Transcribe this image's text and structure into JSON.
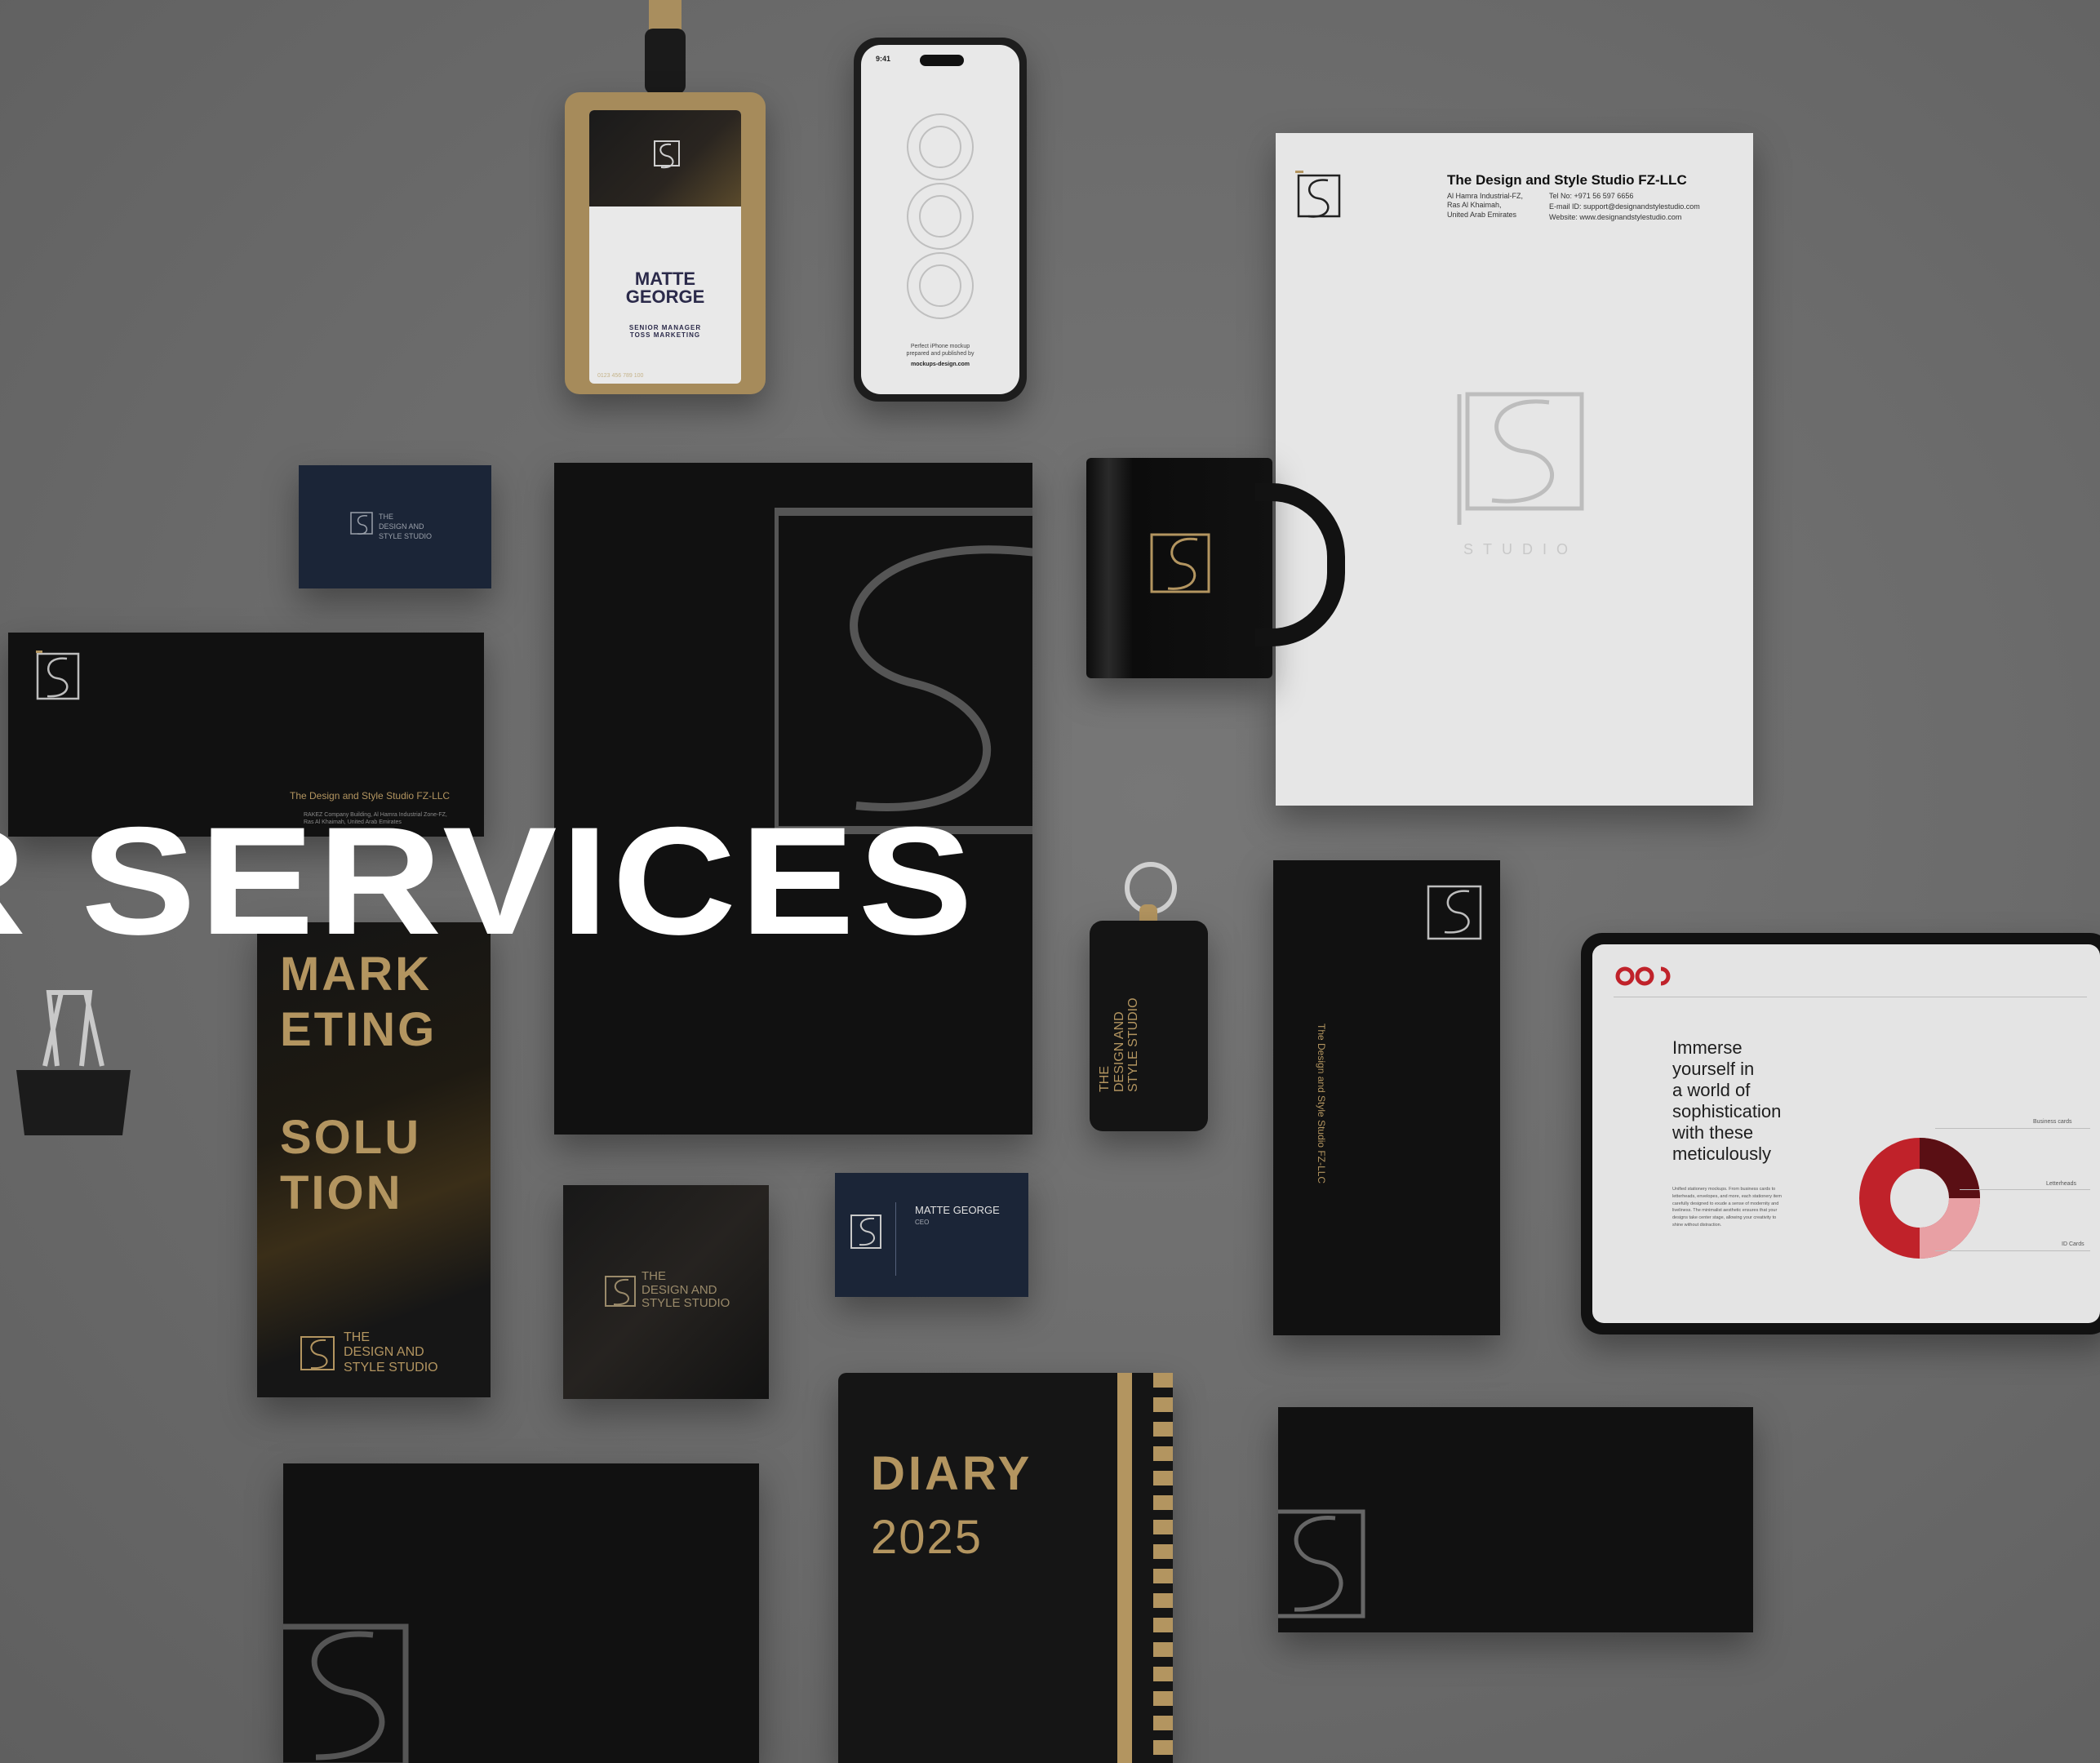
{
  "hero": {
    "headline": "R SERVICES"
  },
  "id_badge": {
    "name": "MATTE\nGEORGE",
    "role": "SENIOR MANAGER\nTOSS MARKETING",
    "phone": "0123 456 789 100"
  },
  "phone_mockup": {
    "time": "9:41",
    "caption": "Perfect iPhone mockup\nprepared and published by",
    "credit": "mockups-design.com"
  },
  "letterhead": {
    "company": "The Design and Style Studio FZ-LLC",
    "address": "Al Hamra Industrial-FZ,\nRas Al Khaimah,\nUnited Arab Emirates",
    "tel": "Tel No: +971 56 597 6656",
    "email": "E-mail ID: support@designandstylestudio.com",
    "website": "Website: www.designandstylestudio.com",
    "logo_word": "STUDIO"
  },
  "small_card": {
    "line1": "THE",
    "line2": "DESIGN AND",
    "line3": "STYLE STUDIO"
  },
  "envelope": {
    "company": "The Design and Style Studio FZ-LLC",
    "address": "RAKEZ Company Building, Al Hamra Industrial Zone-FZ,\nRas Al Khaimah, United Arab Emirates"
  },
  "brochure": {
    "line1": "MARK",
    "line2": "ETING",
    "line3": "SOLU",
    "line4": "TION",
    "brand": "THE\nDESIGN AND\nSTYLE STUDIO"
  },
  "box": {
    "brand": "THE\nDESIGN AND\nSTYLE STUDIO"
  },
  "business_card": {
    "name": "MATTE GEORGE",
    "title": "CEO"
  },
  "keychain": {
    "brand": "THE\nDESIGN AND\nSTYLE STUDIO"
  },
  "dl_envelope": {
    "company": "The Design and Style Studio FZ-LLC"
  },
  "diary": {
    "title": "DIARY",
    "year": "2025"
  },
  "tablet": {
    "heading": "Immerse\nyourself in\na world of\nsophistication\nwith these\nmeticulously",
    "body": "Unified stationery mockups. From business cards to letterheads, envelopes, and more, each stationery item carefully designed to exude a sense of modernity and liveliness. The minimalist aesthetic ensures that your designs take center stage, allowing your creativity to shine without distraction.",
    "chart_labels": [
      "Business cards",
      "Letterheads",
      "ID Cards"
    ]
  },
  "colors": {
    "gold": "#b39560",
    "navy": "#1b2537",
    "red": "#c0222a"
  }
}
